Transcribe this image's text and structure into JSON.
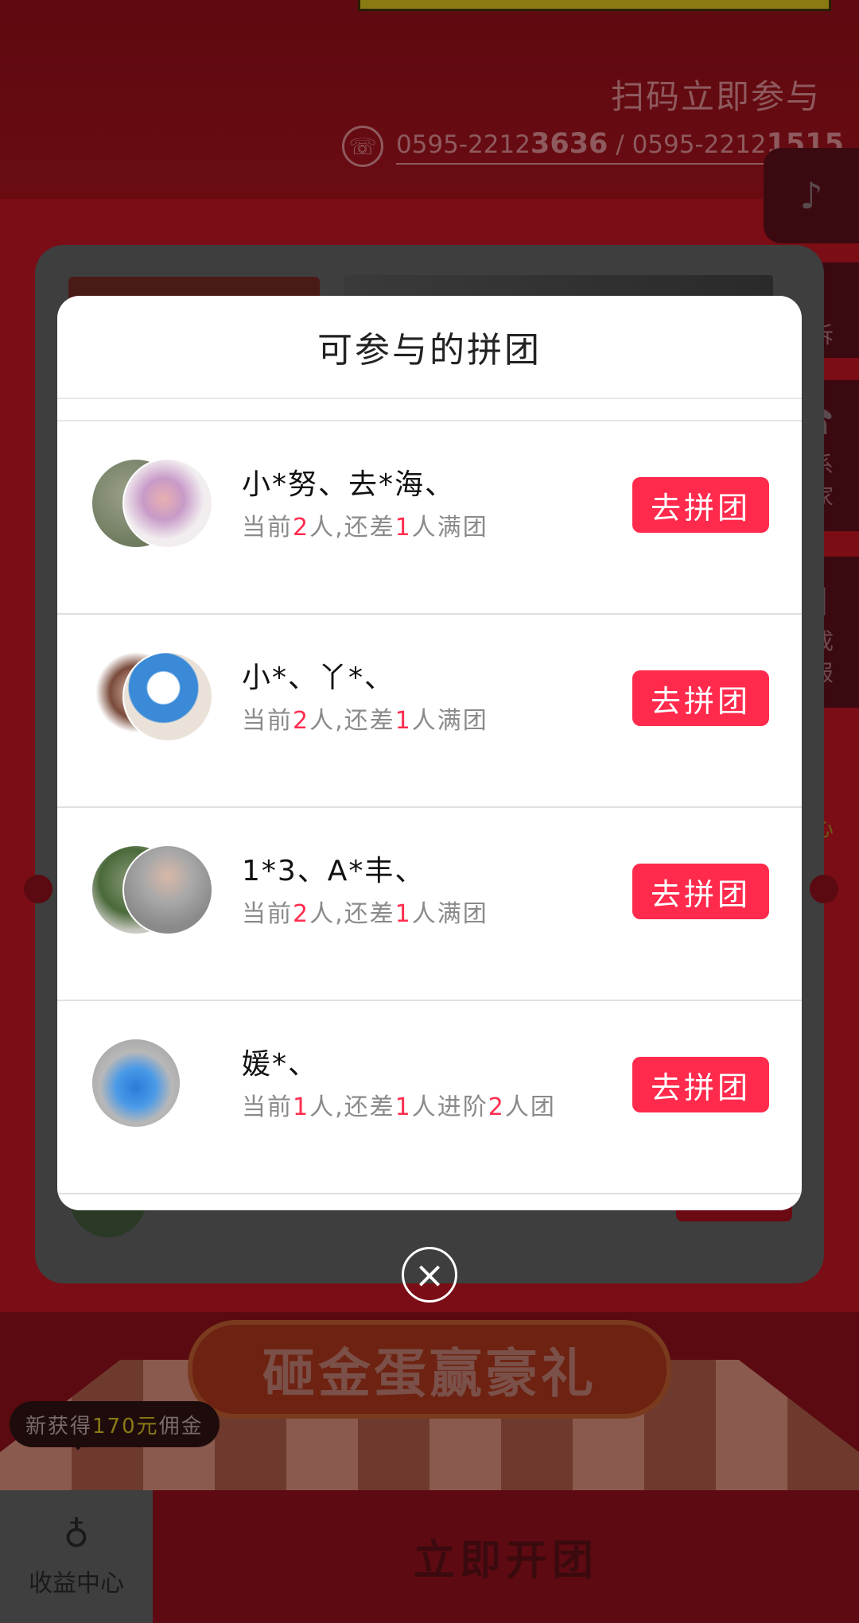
{
  "background": {
    "scan_text": "扫码立即参与",
    "phone_prefix_1": "0595-2212",
    "phone_bold_1": "3636",
    "phone_sep": " / ",
    "phone_prefix_2": "0595-2212",
    "phone_bold_2": "1515",
    "side_buttons": {
      "complaint": "投诉",
      "contact": "联系\n商家",
      "poster": "生成\n海报",
      "center": "中心"
    },
    "egg_banner": "砸金蛋赢豪礼",
    "commission": {
      "prefix": "新获得",
      "amount": "170元",
      "suffix": "佣金"
    },
    "income_center": "收益中心",
    "start_group": "立即开团"
  },
  "modal": {
    "title": "可参与的拼团",
    "join_label": "去拼团",
    "groups": [
      {
        "names": "小*努、去*海、",
        "status_parts": [
          "当前",
          "2",
          "人,还差",
          "1",
          "人满团"
        ]
      },
      {
        "names": "小*、丫*、",
        "status_parts": [
          "当前",
          "2",
          "人,还差",
          "1",
          "人满团"
        ]
      },
      {
        "names": "1*3、A*丰、",
        "status_parts": [
          "当前",
          "2",
          "人,还差",
          "1",
          "人满团"
        ]
      },
      {
        "names": "媛*、",
        "status_parts": [
          "当前",
          "1",
          "人,还差",
          "1",
          "人进阶",
          "2",
          "人团"
        ]
      }
    ]
  },
  "colors": {
    "accent": "#ff2a4c",
    "overlay_red": "#7a0d15"
  },
  "icons": [
    "phone-icon",
    "music-icon",
    "complaint-icon",
    "contact-phone-icon",
    "poster-icon",
    "star-icon",
    "money-bag-icon",
    "close-icon"
  ]
}
